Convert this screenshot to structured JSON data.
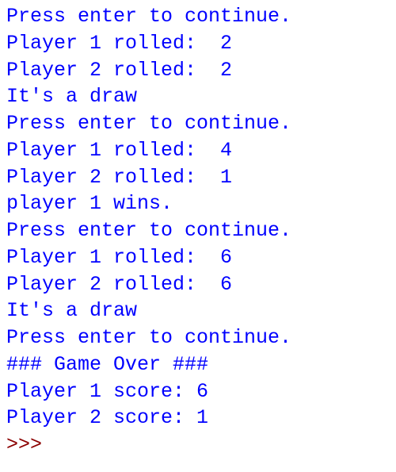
{
  "output_lines": [
    "Press enter to continue.",
    "Player 1 rolled:  2",
    "Player 2 rolled:  2",
    "It's a draw",
    "Press enter to continue.",
    "Player 1 rolled:  4",
    "Player 2 rolled:  1",
    "player 1 wins.",
    "Press enter to continue.",
    "Player 1 rolled:  6",
    "Player 2 rolled:  6",
    "It's a draw",
    "Press enter to continue.",
    "### Game Over ###",
    "Player 1 score: 6",
    "Player 2 score: 1",
    ""
  ],
  "prompt": ">>> "
}
